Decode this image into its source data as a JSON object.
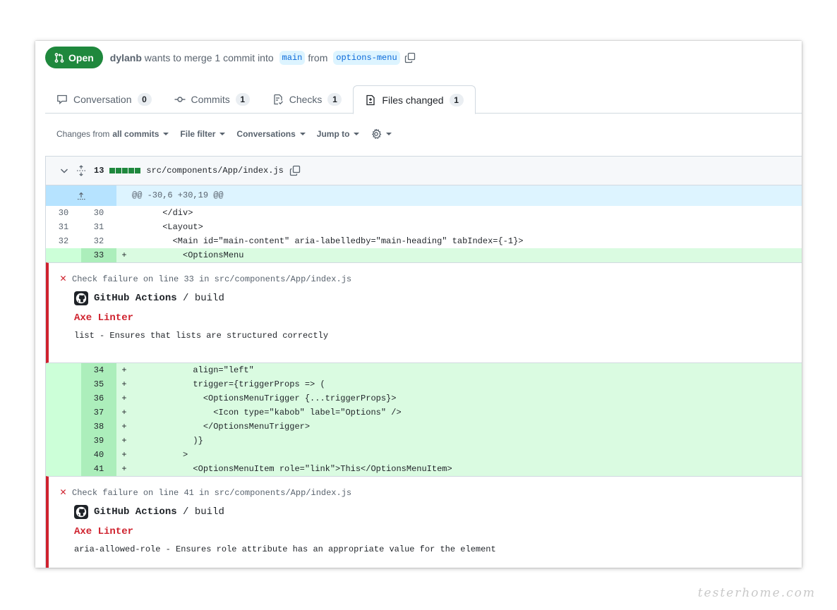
{
  "pr": {
    "state": "Open",
    "author": "dylanb",
    "merge_text": "wants to merge 1 commit into",
    "base_branch": "main",
    "from_text": "from",
    "head_branch": "options-menu"
  },
  "tabs": [
    {
      "label": "Conversation",
      "count": "0",
      "icon": "comment-icon"
    },
    {
      "label": "Commits",
      "count": "1",
      "icon": "commit-icon"
    },
    {
      "label": "Checks",
      "count": "1",
      "icon": "checklist-icon"
    },
    {
      "label": "Files changed",
      "count": "1",
      "icon": "file-diff-icon",
      "selected": true
    }
  ],
  "toolbar": {
    "changes_prefix": "Changes from",
    "changes_value": "all commits",
    "file_filter": "File filter",
    "conversations": "Conversations",
    "jump_to": "Jump to",
    "settings_icon": "gear-icon"
  },
  "file": {
    "changes": "13",
    "path": "src/components/App/index.js",
    "hunk": "@@ -30,6 +30,19 @@"
  },
  "lines": [
    {
      "old": "30",
      "new": "30",
      "sign": "",
      "text": "      </div>"
    },
    {
      "old": "31",
      "new": "31",
      "sign": "",
      "text": "      <Layout>"
    },
    {
      "old": "32",
      "new": "32",
      "sign": "",
      "text": "        <Main id=\"main-content\" aria-labelledby=\"main-heading\" tabIndex={-1}>"
    },
    {
      "old": "",
      "new": "33",
      "sign": "+",
      "text": "          <OptionsMenu"
    }
  ],
  "annotations": [
    {
      "location": "Check failure on line 33 in src/components/App/index.js",
      "app": "GitHub Actions",
      "job": "/ build",
      "title": "Axe Linter",
      "message": "list - Ensures that lists are structured correctly"
    },
    {
      "location": "Check failure on line 41 in src/components/App/index.js",
      "app": "GitHub Actions",
      "job": "/ build",
      "title": "Axe Linter",
      "message": "aria-allowed-role - Ensures role attribute has an appropriate value for the element"
    }
  ],
  "lines2": [
    {
      "new": "34",
      "sign": "+",
      "text": "            align=\"left\""
    },
    {
      "new": "35",
      "sign": "+",
      "text": "            trigger={triggerProps => ("
    },
    {
      "new": "36",
      "sign": "+",
      "text": "              <OptionsMenuTrigger {...triggerProps}>"
    },
    {
      "new": "37",
      "sign": "+",
      "text": "                <Icon type=\"kabob\" label=\"Options\" />"
    },
    {
      "new": "38",
      "sign": "+",
      "text": "              </OptionsMenuTrigger>"
    },
    {
      "new": "39",
      "sign": "+",
      "text": "            )}"
    },
    {
      "new": "40",
      "sign": "+",
      "text": "          >"
    },
    {
      "new": "41",
      "sign": "+",
      "text": "            <OptionsMenuItem role=\"link\">This</OptionsMenuItem>"
    }
  ],
  "watermark": "testerhome.com"
}
